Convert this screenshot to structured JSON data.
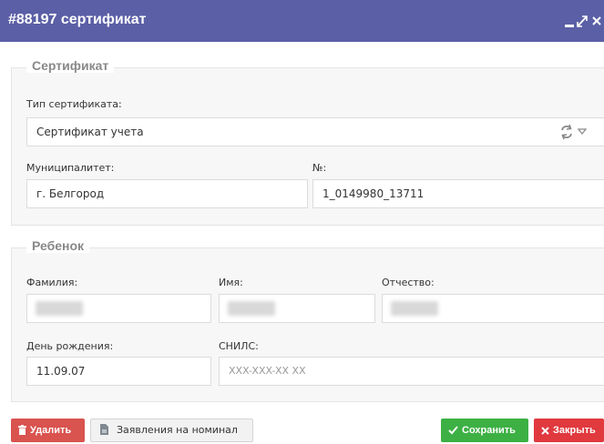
{
  "window": {
    "title": "#88197 сертификат"
  },
  "certificate": {
    "legend": "Сертификат",
    "type_label": "Тип сертификата:",
    "type_value": "Сертификат учета",
    "municipality_label": "Муниципалитет:",
    "municipality_value": "г. Белгород",
    "number_label": "№:",
    "number_value": "1_0149980_13711"
  },
  "child": {
    "legend": "Ребенок",
    "last_name_label": "Фамилия:",
    "first_name_label": "Имя:",
    "patronymic_label": "Отчество:",
    "birthday_label": "День рождения:",
    "birthday_value": "11.09.07",
    "snils_label": "СНИЛС:",
    "snils_placeholder": "XXX-XXX-XX XX"
  },
  "footer": {
    "delete_label": "Удалить",
    "applications_label": "Заявления на номинал",
    "save_label": "Сохранить",
    "close_label": "Закрыть"
  },
  "colors": {
    "titlebar": "#5b5fa6",
    "delete": "#d9534f",
    "save": "#3db044",
    "close": "#e0393e"
  },
  "icons": [
    "minimize-icon",
    "maximize-icon",
    "close-icon",
    "refresh-icon",
    "chevron-down-icon",
    "trash-icon",
    "document-icon",
    "check-icon",
    "x-icon"
  ]
}
